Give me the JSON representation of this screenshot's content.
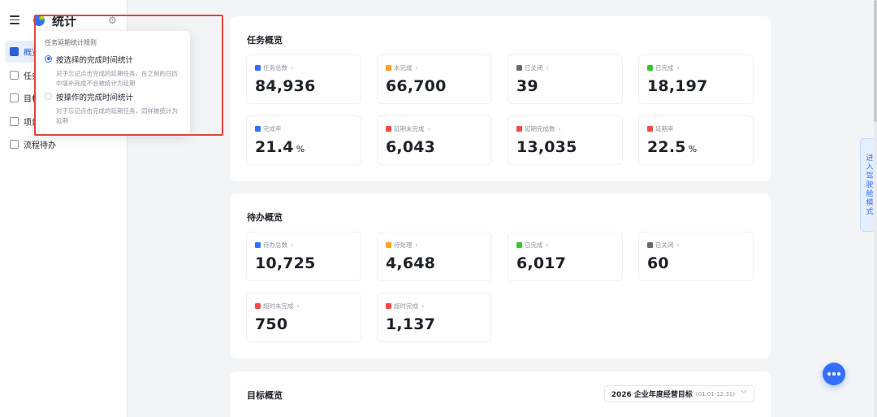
{
  "app": {
    "title": "统计"
  },
  "nav": {
    "items": [
      {
        "label": "概览",
        "active": true
      },
      {
        "label": "任务"
      },
      {
        "label": "目标"
      },
      {
        "label": "项目"
      },
      {
        "label": "流程待办"
      }
    ]
  },
  "popover": {
    "title": "任务延期统计规则",
    "options": [
      {
        "label": "按选择的完成时间统计",
        "desc": "对于忘记点击完成的延期任务，在之前的日历中填补完成不会被统计为延期",
        "selected": true
      },
      {
        "label": "按操作的完成时间统计",
        "desc": "对于忘记点击完成的延期任务，同样被统计为延期",
        "selected": false
      }
    ]
  },
  "tasks": {
    "title": "任务概览",
    "stats": [
      {
        "label": "任务总数",
        "value": "84,936",
        "color": "#3370ff"
      },
      {
        "label": "未完成",
        "value": "66,700",
        "color": "#ffa31a"
      },
      {
        "label": "已关闭",
        "value": "39",
        "color": "#646a73"
      },
      {
        "label": "已完成",
        "value": "18,197",
        "color": "#34c724"
      },
      {
        "label": "完成率",
        "value": "21.4",
        "unit": "%",
        "color": "#3370ff"
      },
      {
        "label": "延期未完成",
        "value": "6,043",
        "color": "#f54a45"
      },
      {
        "label": "延期完成数",
        "value": "13,035",
        "color": "#f54a45"
      },
      {
        "label": "延期率",
        "value": "22.5",
        "unit": "%",
        "color": "#f54a45"
      }
    ]
  },
  "todos": {
    "title": "待办概览",
    "stats": [
      {
        "label": "待办总数",
        "value": "10,725",
        "color": "#3370ff"
      },
      {
        "label": "待处理",
        "value": "4,648",
        "color": "#ffa31a"
      },
      {
        "label": "已完成",
        "value": "6,017",
        "color": "#34c724"
      },
      {
        "label": "已关闭",
        "value": "60",
        "color": "#646a73"
      },
      {
        "label": "超时未完成",
        "value": "750",
        "color": "#f54a45"
      },
      {
        "label": "超时完成",
        "value": "1,137",
        "color": "#f54a45"
      }
    ]
  },
  "goals": {
    "title": "目标概览",
    "selector": {
      "label": "2026 企业年度经营目标",
      "range": "(01.01-12.31)"
    }
  },
  "drive_mode": "进入驾驶舱模式"
}
